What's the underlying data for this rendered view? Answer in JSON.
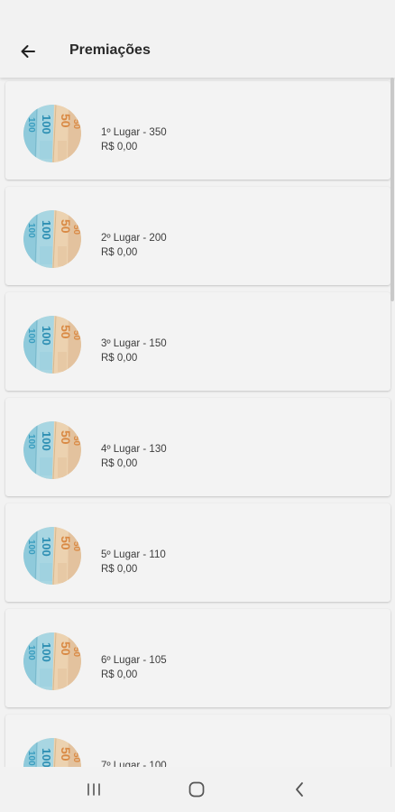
{
  "header": {
    "title": "Premiações"
  },
  "icons": {
    "back": "arrow-left-icon",
    "prize": "money-bills-icon",
    "nav_recents": "recents-icon",
    "nav_home": "home-icon",
    "nav_back": "chevron-left-icon"
  },
  "prizes": [
    {
      "label": "1º Lugar - 350",
      "amount": "R$ 0,00"
    },
    {
      "label": "2º Lugar - 200",
      "amount": "R$ 0,00"
    },
    {
      "label": "3º Lugar - 150",
      "amount": "R$ 0,00"
    },
    {
      "label": "4º Lugar - 130",
      "amount": "R$ 0,00"
    },
    {
      "label": "5º Lugar - 110",
      "amount": "R$ 0,00"
    },
    {
      "label": "6º Lugar - 105",
      "amount": "R$ 0,00"
    },
    {
      "label": "7º Lugar - 100",
      "amount": ""
    }
  ]
}
